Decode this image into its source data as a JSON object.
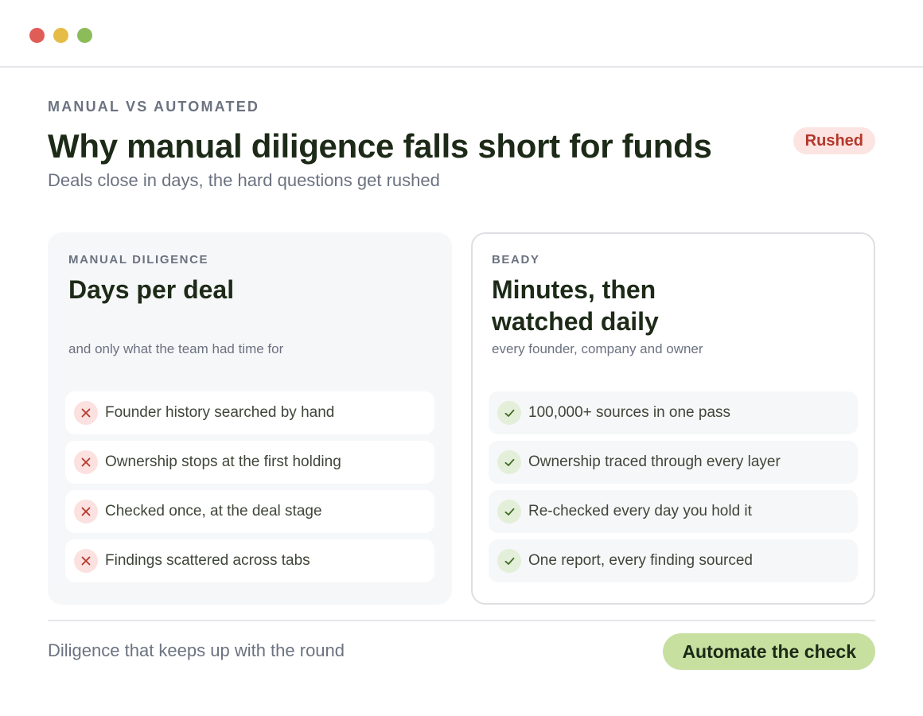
{
  "window": {
    "controls": [
      "close",
      "minimize",
      "maximize"
    ]
  },
  "header": {
    "eyebrow": "MANUAL VS AUTOMATED",
    "title": "Why manual diligence falls short for funds",
    "subtitle": "Deals close in days, the hard questions get rushed",
    "badge": "Rushed"
  },
  "manual": {
    "label": "MANUAL DILIGENCE",
    "title": "Days per deal",
    "subtitle": "and only what the team had time for",
    "icon": "x-icon",
    "items": [
      "Founder history searched by hand",
      "Ownership stops at the first holding",
      "Checked once, at the deal stage",
      "Findings scattered across tabs"
    ]
  },
  "automated": {
    "label": "BEADY",
    "title": "Minutes, then watched daily",
    "subtitle": "every founder, company and owner",
    "icon": "check-icon",
    "items": [
      "100,000+ sources in one pass",
      "Ownership traced through every layer",
      "Re-checked every day you hold it",
      "One report, every finding sourced"
    ]
  },
  "footer": {
    "text": "Diligence that keeps up with the round",
    "cta": "Automate the check"
  },
  "colors": {
    "accent": "#c7e0a0",
    "negative": "#b4372c",
    "positive": "#3e6b22",
    "heading": "#1c2a17"
  }
}
